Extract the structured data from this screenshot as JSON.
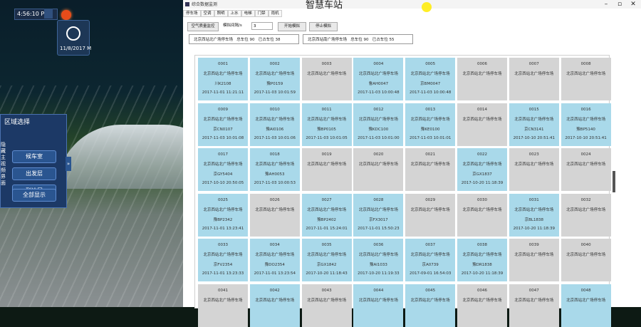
{
  "hud": {
    "time": "4:56:10 PM",
    "date": "11/8/2017 M"
  },
  "region_panel": {
    "title": "区域选择",
    "side_text": "隐藏主视频界面",
    "buttons": [
      "候车室",
      "出发层",
      "到达层",
      "全部显示"
    ]
  },
  "window": {
    "app_title": "综合数据监测",
    "big_title": "智慧车站",
    "tabs": [
      "停车场",
      "空调",
      "照明",
      "上水",
      "电梯",
      "门禁",
      "雨机"
    ],
    "toolbar": {
      "btn_air": "空气质量监控",
      "interval_label": "模拟间隔/s",
      "interval_value": "3",
      "btn_start": "开始模拟",
      "btn_stop": "停止模拟"
    },
    "stats": [
      {
        "name": "北京西站北广场停车场",
        "total_label": "总车位",
        "total": "90",
        "occ_label": "已占车位",
        "occ": "38"
      },
      {
        "name": "北京西站南广场停车场",
        "total_label": "总车位",
        "total": "90",
        "occ_label": "已占车位",
        "occ": "55"
      }
    ]
  },
  "lot_name": "北京西站北广场停车场",
  "spaces": [
    {
      "id": "0001",
      "occ": true,
      "plate": "川K2108",
      "time": "2017-11-01 11:21:11"
    },
    {
      "id": "0002",
      "occ": true,
      "plate": "豫P0159",
      "time": "2017-11-03 10:01:59"
    },
    {
      "id": "0003",
      "occ": false
    },
    {
      "id": "0004",
      "occ": true,
      "plate": "鲁AH0047",
      "time": "2017-11-03 10:00:48"
    },
    {
      "id": "0005",
      "occ": true,
      "plate": "京BM0047",
      "time": "2017-11-03 10:00:48"
    },
    {
      "id": "0006",
      "occ": false
    },
    {
      "id": "0007",
      "occ": false
    },
    {
      "id": "0008",
      "occ": false
    },
    {
      "id": "0009",
      "occ": true,
      "plate": "京CN0107",
      "time": "2017-11-03 10:01:08"
    },
    {
      "id": "0010",
      "occ": true,
      "plate": "豫AI0106",
      "time": "2017-11-03 10:01:06"
    },
    {
      "id": "0011",
      "occ": true,
      "plate": "豫BP0105",
      "time": "2017-11-03 10:01:05"
    },
    {
      "id": "0012",
      "occ": true,
      "plate": "豫KDC100",
      "time": "2017-11-03 10:01:00"
    },
    {
      "id": "0013",
      "occ": true,
      "plate": "豫KE0100",
      "time": "2017-11-03 10:01:01"
    },
    {
      "id": "0014",
      "occ": false
    },
    {
      "id": "0015",
      "occ": true,
      "plate": "京CN3141",
      "time": "2017-10-10 20:51:41"
    },
    {
      "id": "0016",
      "occ": true,
      "plate": "豫BP5140",
      "time": "2017-10-10 20:51:41"
    },
    {
      "id": "0017",
      "occ": true,
      "plate": "京GY5404",
      "time": "2017-10-10 20:50:05"
    },
    {
      "id": "0018",
      "occ": true,
      "plate": "豫AH0053",
      "time": "2017-11-03 10:00:53"
    },
    {
      "id": "0019",
      "occ": false
    },
    {
      "id": "0020",
      "occ": false
    },
    {
      "id": "0021",
      "occ": false
    },
    {
      "id": "0022",
      "occ": true,
      "plate": "京GX1837",
      "time": "2017-10-20 11:18:39"
    },
    {
      "id": "0023",
      "occ": false
    },
    {
      "id": "0024",
      "occ": false
    },
    {
      "id": "0025",
      "occ": true,
      "plate": "豫BP2342",
      "time": "2017-11-01 13:23:41"
    },
    {
      "id": "0026",
      "occ": false
    },
    {
      "id": "0027",
      "occ": true,
      "plate": "豫BP2402",
      "time": "2017-11-01 15:24:01"
    },
    {
      "id": "0028",
      "occ": true,
      "plate": "京FX3017",
      "time": "2017-11-01 15:50:23"
    },
    {
      "id": "0029",
      "occ": false
    },
    {
      "id": "0030",
      "occ": false
    },
    {
      "id": "0031",
      "occ": true,
      "plate": "京BL1838",
      "time": "2017-10-20 11:18:39"
    },
    {
      "id": "0032",
      "occ": false
    },
    {
      "id": "0033",
      "occ": true,
      "plate": "京FV2354",
      "time": "2017-11-01 13:23:33"
    },
    {
      "id": "0034",
      "occ": true,
      "plate": "豫DO2354",
      "time": "2017-11-01 13:23:54"
    },
    {
      "id": "0035",
      "occ": true,
      "plate": "京GX1842",
      "time": "2017-10-20 11:18:43"
    },
    {
      "id": "0036",
      "occ": true,
      "plate": "豫AI1033",
      "time": "2017-10-20 11:19:33"
    },
    {
      "id": "0037",
      "occ": true,
      "plate": "京A0739",
      "time": "2017-09-01 16:54:03"
    },
    {
      "id": "0038",
      "occ": true,
      "plate": "豫DR1838",
      "time": "2017-10-20 11:18:39"
    },
    {
      "id": "0039",
      "occ": false
    },
    {
      "id": "0040",
      "occ": false
    },
    {
      "id": "0041",
      "occ": false
    },
    {
      "id": "0042",
      "occ": true
    },
    {
      "id": "0043",
      "occ": false
    },
    {
      "id": "0044",
      "occ": true
    },
    {
      "id": "0045",
      "occ": true
    },
    {
      "id": "0046",
      "occ": false
    },
    {
      "id": "0047",
      "occ": false
    },
    {
      "id": "0048",
      "occ": true
    }
  ]
}
